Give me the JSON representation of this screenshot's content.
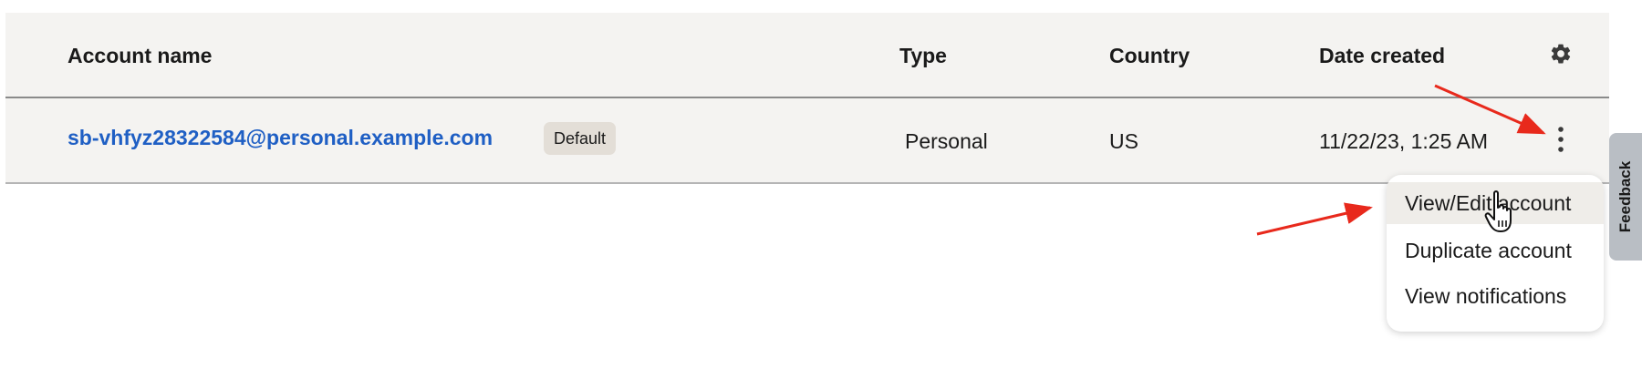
{
  "table": {
    "columns": [
      "Account name",
      "Type",
      "Country",
      "Date created"
    ],
    "rows": [
      {
        "account_name": "sb-vhfyz28322584@personal.example.com",
        "badge": "Default",
        "type": "Personal",
        "country": "US",
        "date_created": "11/22/23, 1:25 AM"
      }
    ]
  },
  "menu": {
    "items": [
      "View/Edit account",
      "Duplicate account",
      "View notifications"
    ],
    "hovered_index": 0
  },
  "feedback": {
    "label": "Feedback"
  },
  "icons": {
    "settings": "gear-icon",
    "row_actions": "kebab-menu-icon",
    "pointer": "hand-pointer-icon"
  },
  "colors": {
    "link": "#1f5fc4",
    "table_bg": "#f4f3f1",
    "badge_bg": "#e3ded7",
    "menu_hover": "#efede9",
    "feedback_tab": "#b9bec4",
    "arrow": "#e8291c"
  }
}
